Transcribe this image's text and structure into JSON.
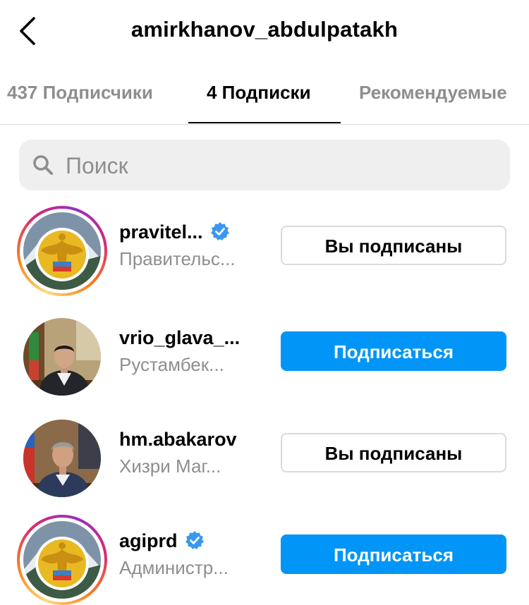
{
  "header": {
    "title": "amirkhanov_abdulpatakh",
    "back_icon": "chevron-left-icon"
  },
  "tabs": [
    {
      "label": "437 Подписчики",
      "active": false
    },
    {
      "label": "4 Подписки",
      "active": true
    },
    {
      "label": "Рекомендуемые",
      "active": false
    }
  ],
  "search": {
    "placeholder": "Поиск",
    "value": "",
    "icon": "search-icon"
  },
  "accounts": [
    {
      "username": "pravitel...",
      "fullname": "Правительс...",
      "verified": true,
      "story_ring": true,
      "avatar": "dagestan-emblem",
      "button": "Вы подписаны",
      "following": true
    },
    {
      "username": "vrio_glava_...",
      "fullname": "Рустамбек...",
      "verified": false,
      "story_ring": false,
      "avatar": "person-photo",
      "button": "Подписаться",
      "following": false
    },
    {
      "username": "hm.abakarov",
      "fullname": "Хизри Маг...",
      "verified": false,
      "story_ring": false,
      "avatar": "person-photo",
      "button": "Вы подписаны",
      "following": true
    },
    {
      "username": "agiprd",
      "fullname": "Администр...",
      "verified": true,
      "story_ring": true,
      "avatar": "dagestan-emblem",
      "button": "Подписаться",
      "following": false
    }
  ],
  "colors": {
    "accent": "#0095f6",
    "muted_text": "#8e8e8e",
    "search_bg": "#efefef",
    "verified_badge": "#3897f0"
  }
}
